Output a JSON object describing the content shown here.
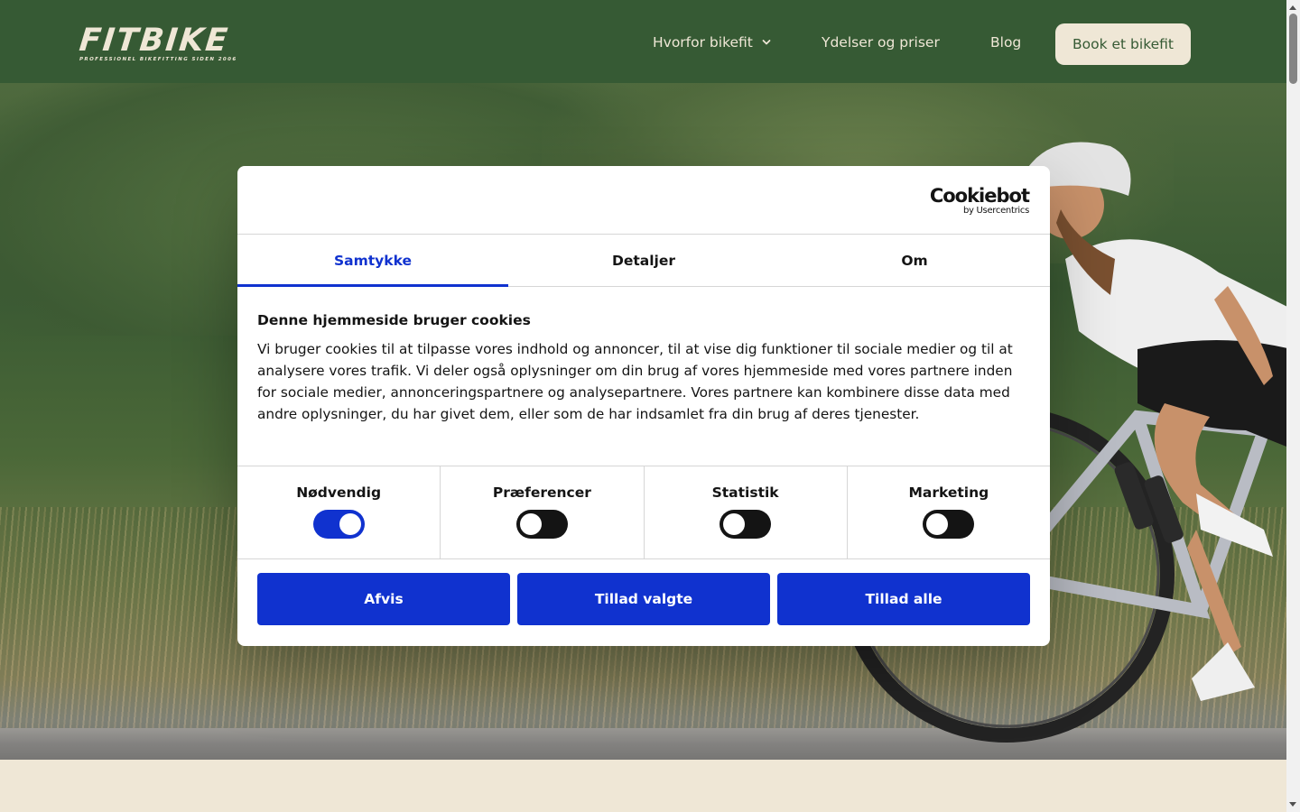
{
  "brand": {
    "logo": "FITBIKE",
    "tagline": "PROFESSIONEL BIKEFITTING SIDEN 2006"
  },
  "nav": {
    "items": [
      {
        "label": "Hvorfor bikefit",
        "icon": "chevron-down-icon"
      },
      {
        "label": "Ydelser og priser"
      },
      {
        "label": "Blog"
      }
    ],
    "cta": "Book et bikefit"
  },
  "colors": {
    "header_bg": "#365a34",
    "cream": "#efe7d6",
    "cookiebot_blue": "#1032cf"
  },
  "cookie_dialog": {
    "provider": "Cookiebot",
    "provider_sub": "by Usercentrics",
    "tabs": [
      {
        "label": "Samtykke",
        "active": true
      },
      {
        "label": "Detaljer",
        "active": false
      },
      {
        "label": "Om",
        "active": false
      }
    ],
    "title": "Denne hjemmeside bruger cookies",
    "description": "Vi bruger cookies til at tilpasse vores indhold og annoncer, til at vise dig funktioner til sociale medier og til at analysere vores trafik. Vi deler også oplysninger om din brug af vores hjemmeside med vores partnere inden for sociale medier, annonceringspartnere og analysepartnere. Vores partnere kan kombinere disse data med andre oplysninger, du har givet dem, eller som de har indsamlet fra din brug af deres tjenester.",
    "categories": [
      {
        "label": "Nødvendig",
        "enabled": true
      },
      {
        "label": "Præferencer",
        "enabled": false
      },
      {
        "label": "Statistik",
        "enabled": false
      },
      {
        "label": "Marketing",
        "enabled": false
      }
    ],
    "buttons": {
      "deny": "Afvis",
      "allow_selected": "Tillad valgte",
      "allow_all": "Tillad alle"
    }
  }
}
